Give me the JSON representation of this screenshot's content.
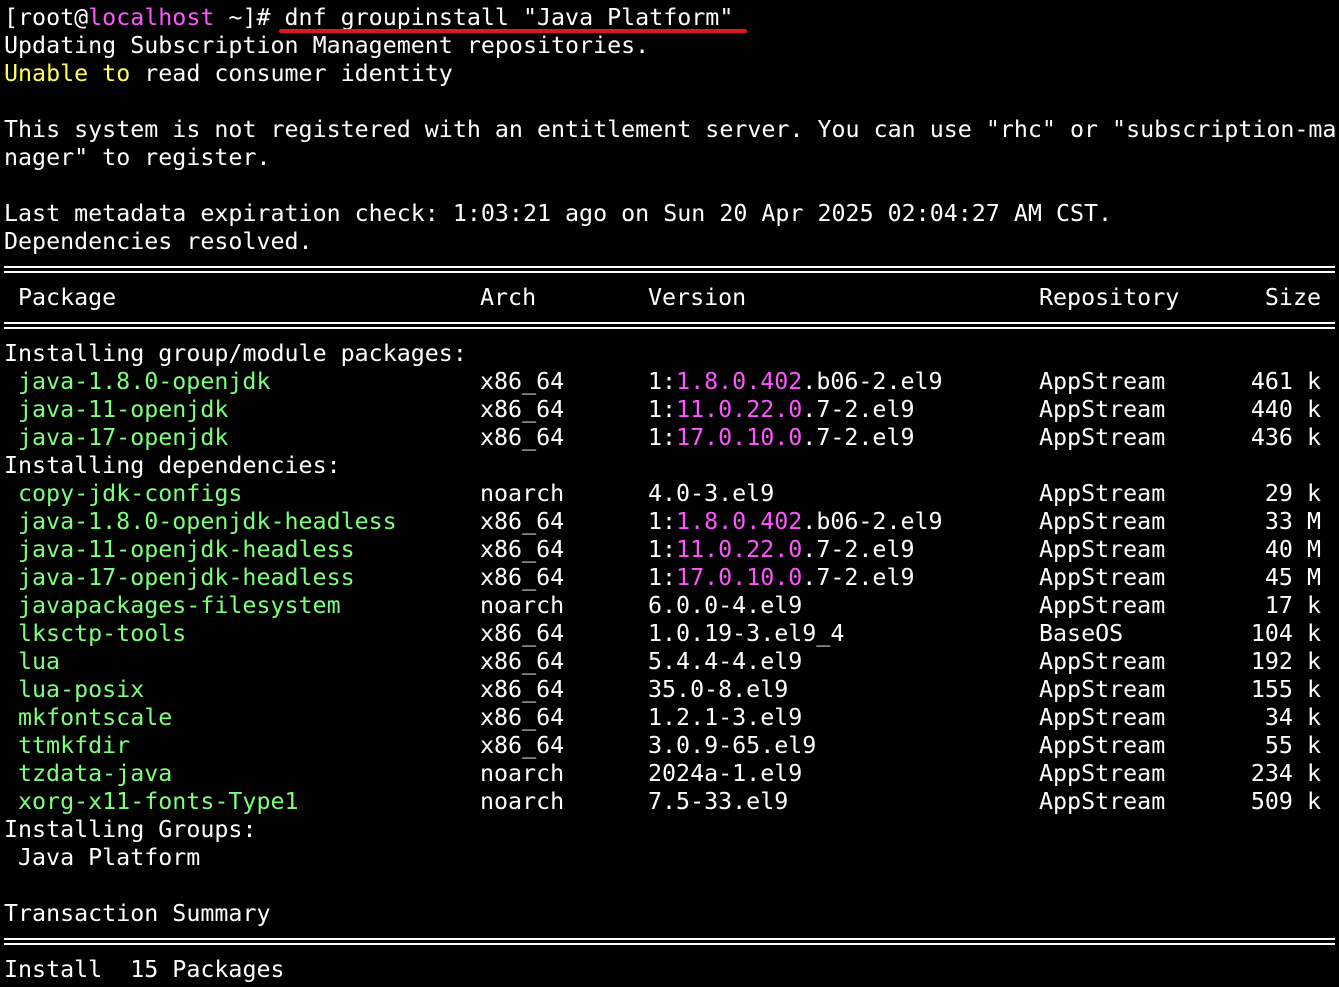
{
  "prompt": {
    "open": "[root@",
    "host": "localhost",
    "rest": " ~]# ",
    "command": "dnf groupinstall \"Java Platform\""
  },
  "messages": {
    "updating": "Updating Subscription Management repositories.",
    "unable_a": "Unable to",
    "unable_b": " read consumer identity",
    "not_registered_1": "This system is not registered with an entitlement server. You can use \"rhc\" or \"subscription-ma",
    "not_registered_2": "nager\" to register.",
    "metadata": "Last metadata expiration check: 1:03:21 ago on Sun 20 Apr 2025 02:04:27 AM CST.",
    "resolved": "Dependencies resolved."
  },
  "table": {
    "headers": {
      "package": "Package",
      "arch": "Arch",
      "version": "Version",
      "repository": "Repository",
      "size": "Size"
    },
    "sections": {
      "group_module": "Installing group/module packages:",
      "dependencies": "Installing dependencies:",
      "groups": "Installing Groups:"
    },
    "group_packages": [
      {
        "name": "java-1.8.0-openjdk",
        "arch": "x86_64",
        "ver_pre": "1:",
        "ver_hl": "1.8.0.402",
        "ver_post": ".b06-2.el9",
        "repo": "AppStream",
        "size": "461 k"
      },
      {
        "name": "java-11-openjdk",
        "arch": "x86_64",
        "ver_pre": "1:",
        "ver_hl": "11.0.22.0",
        "ver_post": ".7-2.el9",
        "repo": "AppStream",
        "size": "440 k"
      },
      {
        "name": "java-17-openjdk",
        "arch": "x86_64",
        "ver_pre": "1:",
        "ver_hl": "17.0.10.0",
        "ver_post": ".7-2.el9",
        "repo": "AppStream",
        "size": "436 k"
      }
    ],
    "dependencies": [
      {
        "name": "copy-jdk-configs",
        "arch": "noarch",
        "ver_pre": "4.0-3.el9",
        "ver_hl": "",
        "ver_post": "",
        "repo": "AppStream",
        "size": "29 k"
      },
      {
        "name": "java-1.8.0-openjdk-headless",
        "arch": "x86_64",
        "ver_pre": "1:",
        "ver_hl": "1.8.0.402",
        "ver_post": ".b06-2.el9",
        "repo": "AppStream",
        "size": "33 M"
      },
      {
        "name": "java-11-openjdk-headless",
        "arch": "x86_64",
        "ver_pre": "1:",
        "ver_hl": "11.0.22.0",
        "ver_post": ".7-2.el9",
        "repo": "AppStream",
        "size": "40 M"
      },
      {
        "name": "java-17-openjdk-headless",
        "arch": "x86_64",
        "ver_pre": "1:",
        "ver_hl": "17.0.10.0",
        "ver_post": ".7-2.el9",
        "repo": "AppStream",
        "size": "45 M"
      },
      {
        "name": "javapackages-filesystem",
        "arch": "noarch",
        "ver_pre": "6.0.0-4.el9",
        "ver_hl": "",
        "ver_post": "",
        "repo": "AppStream",
        "size": "17 k"
      },
      {
        "name": "lksctp-tools",
        "arch": "x86_64",
        "ver_pre": "1.0.19-3.el9_4",
        "ver_hl": "",
        "ver_post": "",
        "repo": "BaseOS",
        "size": "104 k"
      },
      {
        "name": "lua",
        "arch": "x86_64",
        "ver_pre": "5.4.4-4.el9",
        "ver_hl": "",
        "ver_post": "",
        "repo": "AppStream",
        "size": "192 k"
      },
      {
        "name": "lua-posix",
        "arch": "x86_64",
        "ver_pre": "35.0-8.el9",
        "ver_hl": "",
        "ver_post": "",
        "repo": "AppStream",
        "size": "155 k"
      },
      {
        "name": "mkfontscale",
        "arch": "x86_64",
        "ver_pre": "1.2.1-3.el9",
        "ver_hl": "",
        "ver_post": "",
        "repo": "AppStream",
        "size": "34 k"
      },
      {
        "name": "ttmkfdir",
        "arch": "x86_64",
        "ver_pre": "3.0.9-65.el9",
        "ver_hl": "",
        "ver_post": "",
        "repo": "AppStream",
        "size": "55 k"
      },
      {
        "name": "tzdata-java",
        "arch": "noarch",
        "ver_pre": "2024a-1.el9",
        "ver_hl": "",
        "ver_post": "",
        "repo": "AppStream",
        "size": "234 k"
      },
      {
        "name": "xorg-x11-fonts-Type1",
        "arch": "noarch",
        "ver_pre": "7.5-33.el9",
        "ver_hl": "",
        "ver_post": "",
        "repo": "AppStream",
        "size": "509 k"
      }
    ],
    "group_name": "Java Platform"
  },
  "summary": {
    "title": "Transaction Summary",
    "install_line": "Install  15 Packages"
  },
  "colors": {
    "background": "#000000",
    "text": "#ffffff",
    "package_green": "#7cff7c",
    "hostname_magenta": "#ff55ff",
    "version_magenta": "#ff55ff",
    "warning_yellow": "#ffff55",
    "annotation_red": "#e01818"
  }
}
